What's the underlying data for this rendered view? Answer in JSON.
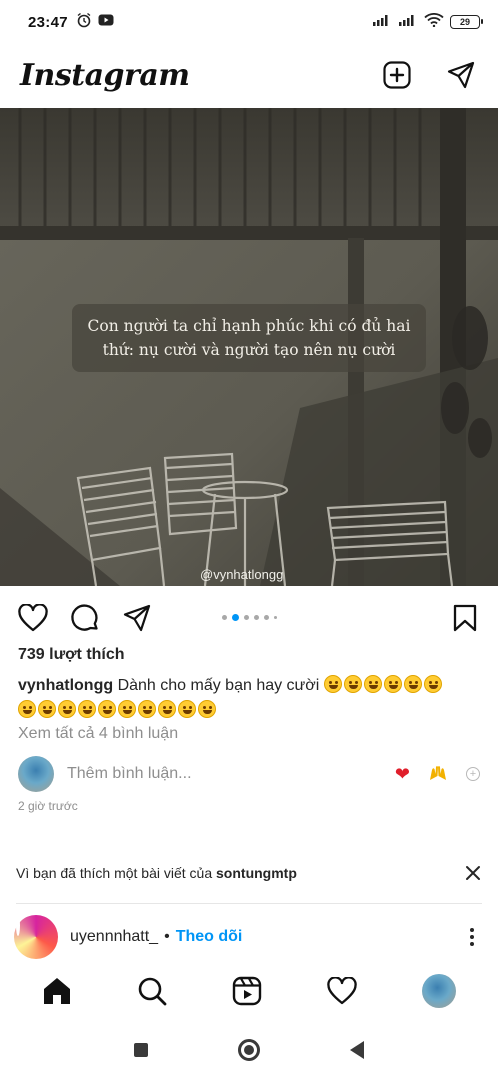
{
  "status_bar": {
    "time": "23:47",
    "battery": "29",
    "icons": [
      "alarm-icon",
      "youtube-icon",
      "signal-icon",
      "signal-icon",
      "wifi-icon",
      "battery-icon"
    ]
  },
  "header": {
    "logo": "Instagram",
    "icons": [
      "new-post-icon",
      "direct-message-icon"
    ]
  },
  "post": {
    "quote": "Con người ta chỉ hạnh phúc khi có đủ hai thứ: nụ cười và người tạo nên nụ cười",
    "watermark": "@vynhatlongg",
    "carousel": {
      "total": 6,
      "active_index": 2
    },
    "likes": "739 lượt thích",
    "username": "vynhatlongg",
    "caption_text": "Dành cho mấy bạn hay cười",
    "emoji_count": 16,
    "view_comments": "Xem tất cả 4 bình luận",
    "comment_placeholder": "Thêm bình luận...",
    "quick_reactions": [
      "❤",
      "🙌",
      "+"
    ],
    "time_ago": "2 giờ trước"
  },
  "suggestion": {
    "reason_prefix": "Vì bạn đã thích một bài viết của ",
    "reason_user": "sontungmtp"
  },
  "next_post": {
    "username": "uyennnhatt_",
    "separator": "•",
    "follow_label": "Theo dõi"
  },
  "tab_bar": {
    "items": [
      "home-icon",
      "search-icon",
      "reels-icon",
      "activity-icon",
      "profile-avatar"
    ]
  },
  "colors": {
    "link_blue": "#0095f6",
    "heart_red": "#e01e2b",
    "text": "#262626",
    "muted": "#8e8e8e"
  }
}
